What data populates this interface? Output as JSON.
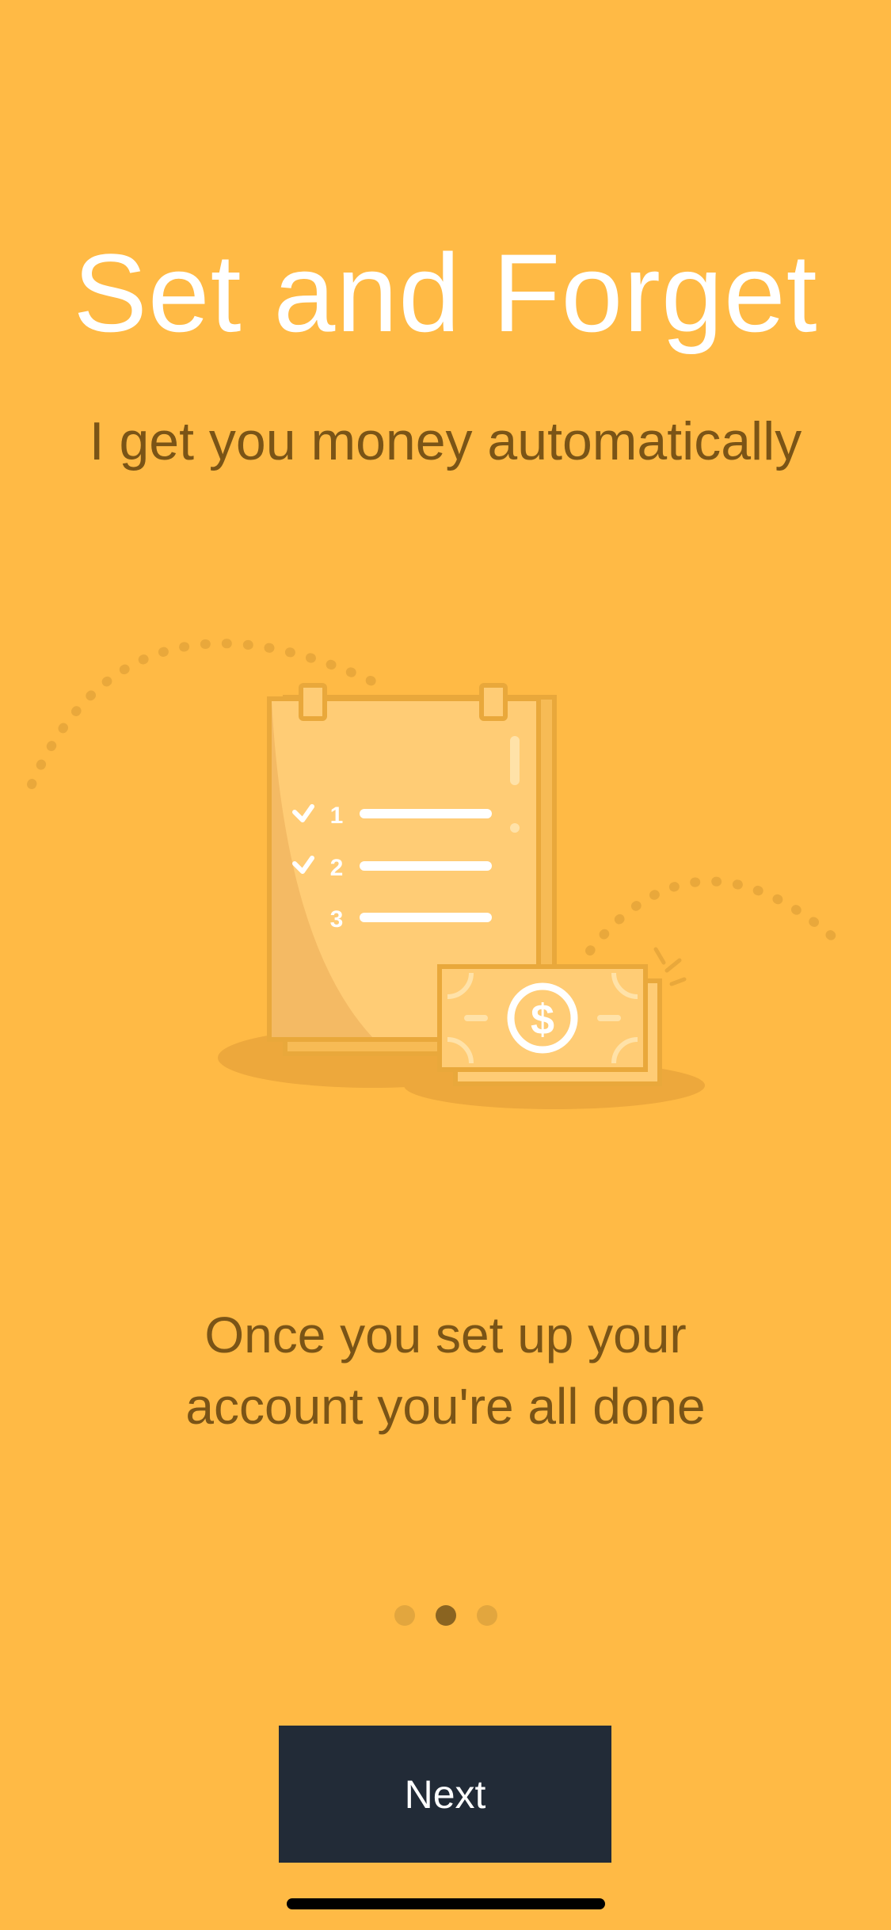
{
  "onboarding": {
    "title": "Set and Forget",
    "subtitle": "I get you money automatically",
    "body_line1": "Once you set up your",
    "body_line2": "account you're all done",
    "checklist": [
      "1",
      "2",
      "3"
    ],
    "currency_symbol": "$",
    "page_indicator": {
      "total": 3,
      "current": 2
    },
    "next_label": "Next"
  },
  "colors": {
    "background": "#FFBA45",
    "button": "#222B37",
    "text_dark": "#7A5416",
    "title": "#FFFFFF"
  }
}
